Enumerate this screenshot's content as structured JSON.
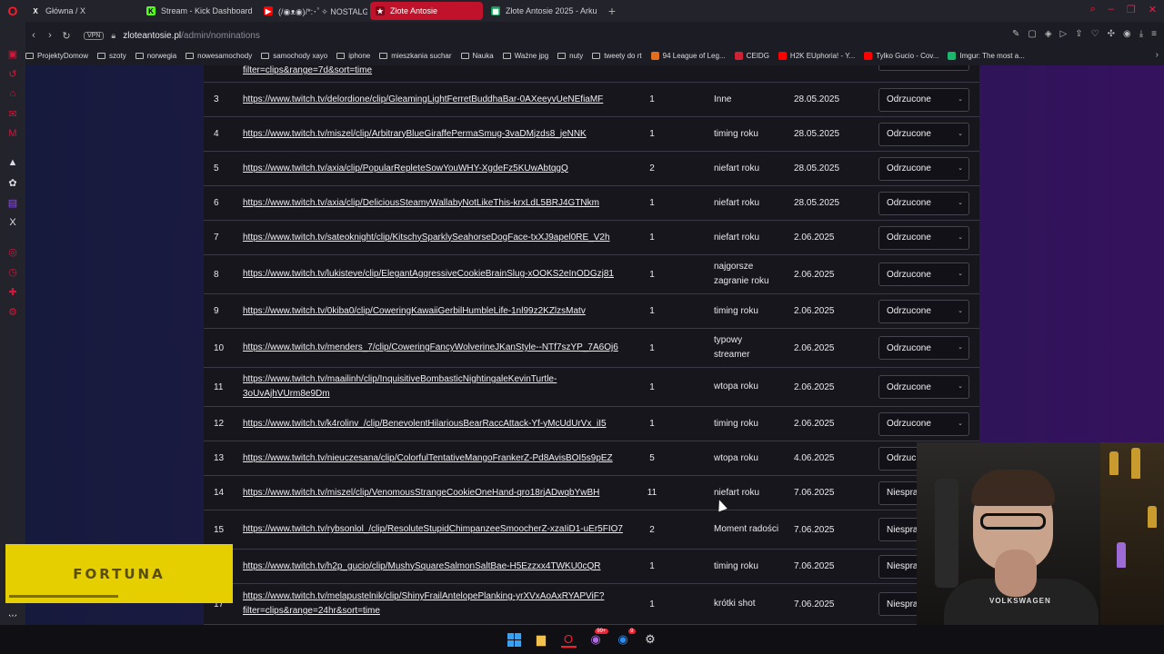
{
  "browser": {
    "tabs": [
      {
        "label": "Główna / X",
        "icon": "x-icon",
        "color": "#ffffff"
      },
      {
        "label": "Stream - Kick Dashboard",
        "icon": "kick-icon",
        "color": "#53fc18"
      },
      {
        "label": "(/◉ᴥ◉)/*:･ﾟ✧ NOSTALGI",
        "icon": "youtube-icon",
        "color": "#ff0000"
      },
      {
        "label": "Złote Antosie",
        "icon": "trophy-icon",
        "color": "#ffffff",
        "active": true
      },
      {
        "label": "Złote Antosie 2025 - Arku",
        "icon": "sheets-icon",
        "color": "#0f9d58"
      }
    ],
    "new_tab": "+",
    "address": {
      "host": "zloteantosie.pl",
      "path": "/admin/nominations",
      "vpn": "VPN"
    }
  },
  "bookmarks": [
    {
      "label": "ProjektyDomow",
      "type": "folder"
    },
    {
      "label": "szoty",
      "type": "folder"
    },
    {
      "label": "norwegia",
      "type": "folder"
    },
    {
      "label": "nowesamochody",
      "type": "folder"
    },
    {
      "label": "samochody xayo",
      "type": "folder"
    },
    {
      "label": "iphone",
      "type": "folder"
    },
    {
      "label": "mieszkania suchar",
      "type": "folder"
    },
    {
      "label": "Nauka",
      "type": "folder"
    },
    {
      "label": "Ważne jpg",
      "type": "folder"
    },
    {
      "label": "nuty",
      "type": "folder"
    },
    {
      "label": "tweety do rt",
      "type": "folder"
    },
    {
      "label": "94 League of Leg...",
      "type": "site",
      "color": "#e07020"
    },
    {
      "label": "CEIDG",
      "type": "site",
      "color": "#cc2233"
    },
    {
      "label": "H2K EUphoria! - Y...",
      "type": "site",
      "color": "#ff0000"
    },
    {
      "label": "Tylko Gucio - Cov...",
      "type": "site",
      "color": "#ff0000"
    },
    {
      "label": "Imgur: The most a...",
      "type": "site",
      "color": "#1bb76e"
    }
  ],
  "table": {
    "partial_top_link": "filter=clips&range=7d&sort=time",
    "rows": [
      {
        "num": "3",
        "link": "https://www.twitch.tv/delordione/clip/GleamingLightFerretBuddhaBar-0AXeeyvUeNEfiaMF",
        "votes": "1",
        "category": "Inne",
        "date": "28.05.2025",
        "status": "Odrzucone"
      },
      {
        "num": "4",
        "link": "https://www.twitch.tv/miszel/clip/ArbitraryBlueGiraffePermaSmug-3vaDMjzds8_jeNNK",
        "votes": "1",
        "category": "timing roku",
        "date": "28.05.2025",
        "status": "Odrzucone"
      },
      {
        "num": "5",
        "link": "https://www.twitch.tv/axia/clip/PopularRepleteSowYouWHY-XgdeFz5KUwAbtqgQ",
        "votes": "2",
        "category": "niefart roku",
        "date": "28.05.2025",
        "status": "Odrzucone"
      },
      {
        "num": "6",
        "link": "https://www.twitch.tv/axia/clip/DeliciousSteamyWallabyNotLikeThis-krxLdL5BRJ4GTNkm",
        "votes": "1",
        "category": "niefart roku",
        "date": "28.05.2025",
        "status": "Odrzucone"
      },
      {
        "num": "7",
        "link": "https://www.twitch.tv/sateoknight/clip/KitschySparklySeahorseDogFace-txXJ9apel0RE_V2h",
        "votes": "1",
        "category": "niefart roku",
        "date": "2.06.2025",
        "status": "Odrzucone"
      },
      {
        "num": "8",
        "link": "https://www.twitch.tv/lukisteve/clip/ElegantAggressiveCookieBrainSlug-xOOKS2eInODGzj81",
        "votes": "1",
        "category": "najgorsze zagranie roku",
        "date": "2.06.2025",
        "status": "Odrzucone"
      },
      {
        "num": "9",
        "link": "https://www.twitch.tv/0kiba0/clip/CoweringKawaiiGerbilHumbleLife-1nl99z2KZlzsMatv",
        "votes": "1",
        "category": "timing roku",
        "date": "2.06.2025",
        "status": "Odrzucone"
      },
      {
        "num": "10",
        "link": "https://www.twitch.tv/menders_7/clip/CoweringFancyWolverineJKanStyle--NTf7szYP_7A6Oj6",
        "votes": "1",
        "category": "typowy streamer",
        "date": "2.06.2025",
        "status": "Odrzucone"
      },
      {
        "num": "11",
        "link": "https://www.twitch.tv/maailinh/clip/InquisitiveBombasticNightingaleKevinTurtle-3oUvAjhVUrm8e9Dm",
        "votes": "1",
        "category": "wtopa roku",
        "date": "2.06.2025",
        "status": "Odrzucone"
      },
      {
        "num": "12",
        "link": "https://www.twitch.tv/k4rolinv_/clip/BenevolentHilariousBearRaccAttack-Yf-yMcUdUrVx_iI5",
        "votes": "1",
        "category": "timing roku",
        "date": "2.06.2025",
        "status": "Odrzucone"
      },
      {
        "num": "13",
        "link": "https://www.twitch.tv/nieuczesana/clip/ColorfulTentativeMangoFrankerZ-Pd8AvisBOI5s9pEZ",
        "votes": "5",
        "category": "wtopa roku",
        "date": "4.06.2025",
        "status": "Odrzuc"
      },
      {
        "num": "14",
        "link": "https://www.twitch.tv/miszel/clip/VenomousStrangeCookieOneHand-qro18rjADwqbYwBH",
        "votes": "11",
        "category": "niefart roku",
        "date": "7.06.2025",
        "status": "Niespra"
      },
      {
        "num": "15",
        "link": "https://www.twitch.tv/rybsonlol_/clip/ResoluteStupidChimpanzeeSmoocherZ-xzaIiD1-uEr5FIO7",
        "votes": "2",
        "category": "Moment radości",
        "date": "7.06.2025",
        "status": "Niespra"
      },
      {
        "num": "16",
        "link": "https://www.twitch.tv/h2p_gucio/clip/MushySquareSalmonSaltBae-H5Ezzxx4TWKU0cQR",
        "votes": "1",
        "category": "timing roku",
        "date": "7.06.2025",
        "status": "Niespra"
      },
      {
        "num": "17",
        "link": "https://www.twitch.tv/melapustelnik/clip/ShinyFrailAntelopePlanking-yrXVxAoAxRYAPViF?filter=clips&range=24hr&sort=time",
        "votes": "1",
        "category": "krótki shot",
        "date": "7.06.2025",
        "status": "Niespra"
      }
    ]
  },
  "overlay": {
    "sponsor": "FORTUNA",
    "webcam_shirt": "VOLKSWAGEN"
  },
  "taskbar": {
    "messenger_badge": "99+",
    "messenger2_badge": "9"
  }
}
